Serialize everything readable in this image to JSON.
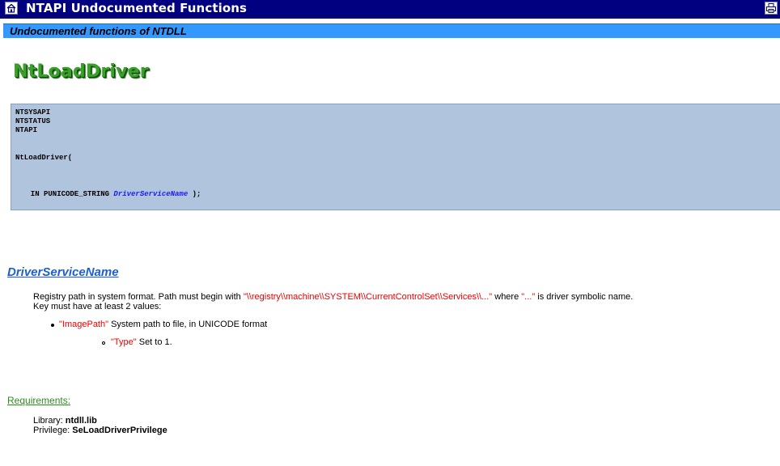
{
  "header": {
    "title": "NTAPI Undocumented Functions",
    "home_icon": "home-icon",
    "print_icon": "print-icon"
  },
  "subheader": {
    "title": "Undocumented functions of NTDLL"
  },
  "function": {
    "name": "NtLoadDriver",
    "syntax": {
      "line1": "NTSYSAPI",
      "line2": "NTSTATUS",
      "line3": "NTAPI",
      "call": "NtLoadDriver(",
      "param_prefix": "  IN PUNICODE_STRING ",
      "param_name": "DriverServiceName",
      "param_suffix": " );"
    }
  },
  "parameter": {
    "name": "DriverServiceName",
    "desc_part1": "Registry path in system format. Path must begin with ",
    "desc_path": "\"\\\\registry\\\\machine\\\\SYSTEM\\\\CurrentControlSet\\\\Services\\\\...\"",
    "desc_part2": " where ",
    "desc_dots": "\"...\"",
    "desc_part3": " is driver symbolic name.",
    "desc_line2": "Key must have at least 2 values:",
    "values": [
      {
        "key": "\"ImagePath\"",
        "text": " System path to file, in UNICODE format"
      },
      {
        "key": "\"Type\"",
        "text": " Set to 1."
      }
    ]
  },
  "requirements": {
    "heading": "Requirements:",
    "library_label": "Library: ",
    "library_value": "ntdll.lib",
    "privilege_label": "Privilege: ",
    "privilege_value": "SeLoadDriverPrivilege"
  }
}
